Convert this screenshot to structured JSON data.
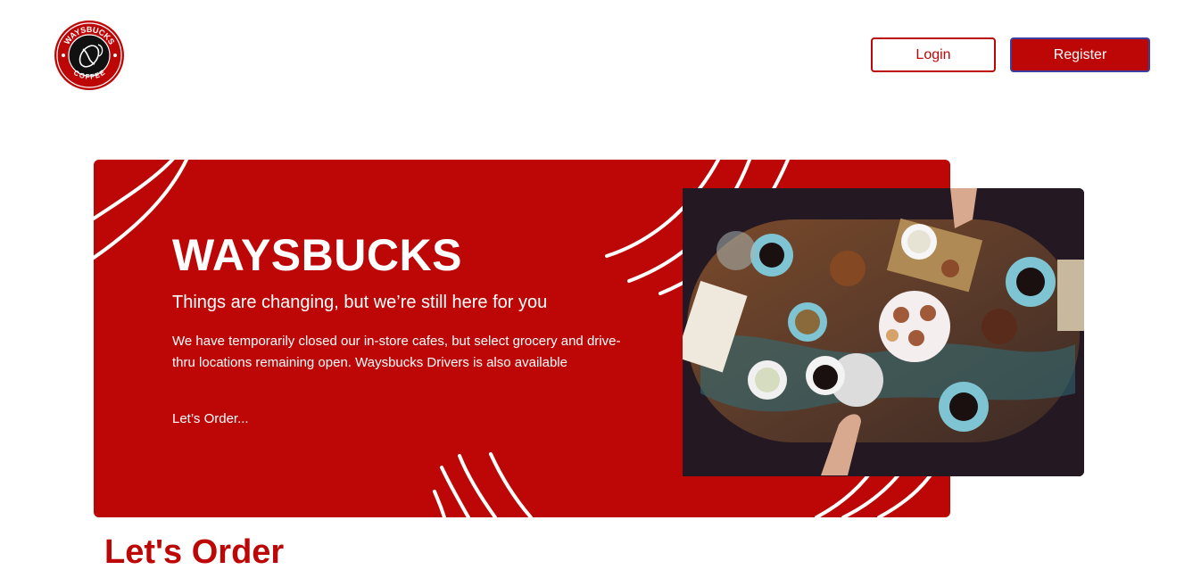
{
  "brand": {
    "logo_text_top": "WAYSBUCKS",
    "logo_text_bottom": "COFFEE"
  },
  "header": {
    "login_label": "Login",
    "register_label": "Register"
  },
  "hero": {
    "title": "WAYSBUCKS",
    "subtitle": "Things are changing, but we’re still here for you",
    "description": "We have temporarily closed our in-store cafes, but select grocery and drive-thru locations remaining open. Waysbucks Drivers is also available",
    "cta": "Let’s Order...",
    "image": "coffee-table-photo"
  },
  "section": {
    "title": "Let's Order"
  },
  "colors": {
    "brand_red": "#bd0707",
    "background": "#ffffff",
    "register_border": "#3b3fa0"
  }
}
